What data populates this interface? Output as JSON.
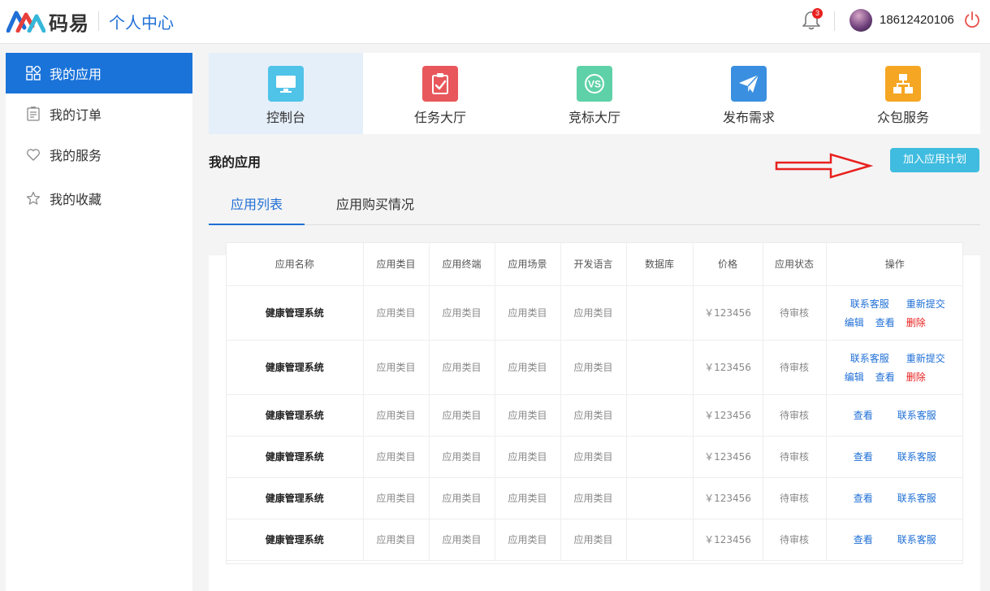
{
  "header": {
    "logo_text": "码易",
    "title": "个人中心",
    "notification_count": "3",
    "username": "18612420106"
  },
  "sidebar": {
    "items": [
      {
        "label": "我的应用",
        "icon": "apps-icon"
      },
      {
        "label": "我的订单",
        "icon": "order-icon"
      },
      {
        "label": "我的服务",
        "icon": "heart-icon"
      },
      {
        "label": "我的收藏",
        "icon": "star-icon"
      }
    ]
  },
  "topnav": {
    "items": [
      {
        "label": "控制台",
        "icon": "monitor-icon",
        "color": "#4fc3e8"
      },
      {
        "label": "任务大厅",
        "icon": "clipboard-icon",
        "color": "#e8575b"
      },
      {
        "label": "竞标大厅",
        "icon": "vs-icon",
        "color": "#5fd1a8"
      },
      {
        "label": "发布需求",
        "icon": "paper-plane-icon",
        "color": "#3a8fe0"
      },
      {
        "label": "众包服务",
        "icon": "org-chart-icon",
        "color": "#f5a623"
      }
    ]
  },
  "section": {
    "title": "我的应用",
    "join_button": "加入应用计划"
  },
  "tabs": [
    "应用列表",
    "应用购买情况"
  ],
  "table": {
    "headers": [
      "应用名称",
      "应用类目",
      "应用终端",
      "应用场景",
      "开发语言",
      "数据库",
      "价格",
      "应用状态",
      "操作"
    ],
    "rows": [
      {
        "name": "健康管理系统",
        "category": "应用类目",
        "terminal": "应用类目",
        "scene": "应用类目",
        "language": "应用类目",
        "database": "",
        "price": "￥123456",
        "status": "待审核",
        "ops": [
          "联系客服",
          "重新提交",
          "编辑",
          "查看",
          "删除"
        ]
      },
      {
        "name": "健康管理系统",
        "category": "应用类目",
        "terminal": "应用类目",
        "scene": "应用类目",
        "language": "应用类目",
        "database": "",
        "price": "￥123456",
        "status": "待审核",
        "ops": [
          "联系客服",
          "重新提交",
          "编辑",
          "查看",
          "删除"
        ]
      },
      {
        "name": "健康管理系统",
        "category": "应用类目",
        "terminal": "应用类目",
        "scene": "应用类目",
        "language": "应用类目",
        "database": "",
        "price": "￥123456",
        "status": "待审核",
        "ops": [
          "查看",
          "联系客服"
        ]
      },
      {
        "name": "健康管理系统",
        "category": "应用类目",
        "terminal": "应用类目",
        "scene": "应用类目",
        "language": "应用类目",
        "database": "",
        "price": "￥123456",
        "status": "待审核",
        "ops": [
          "查看",
          "联系客服"
        ]
      },
      {
        "name": "健康管理系统",
        "category": "应用类目",
        "terminal": "应用类目",
        "scene": "应用类目",
        "language": "应用类目",
        "database": "",
        "price": "￥123456",
        "status": "待审核",
        "ops": [
          "查看",
          "联系客服"
        ]
      },
      {
        "name": "健康管理系统",
        "category": "应用类目",
        "terminal": "应用类目",
        "scene": "应用类目",
        "language": "应用类目",
        "database": "",
        "price": "￥123456",
        "status": "待审核",
        "ops": [
          "查看",
          "联系客服"
        ]
      }
    ]
  }
}
